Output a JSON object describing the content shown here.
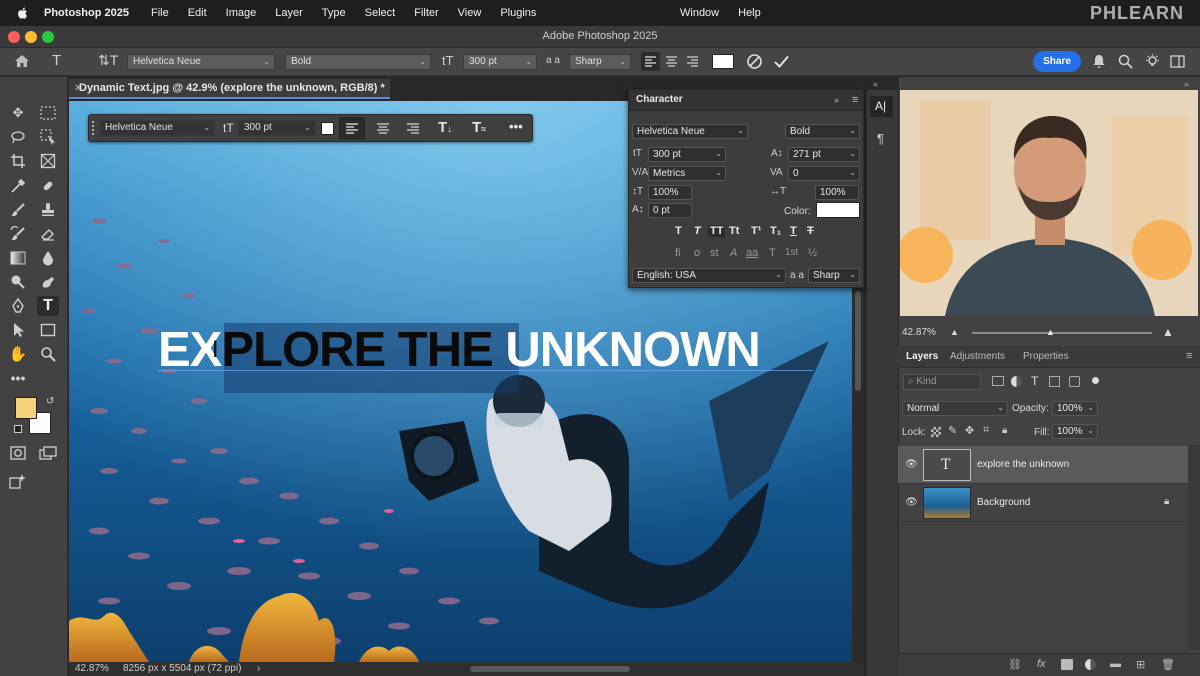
{
  "menubar": {
    "app_name": "Photoshop 2025",
    "items": [
      "File",
      "Edit",
      "Image",
      "Layer",
      "Type",
      "Select",
      "Filter",
      "View",
      "Plugins"
    ],
    "right_items": [
      "Window",
      "Help"
    ],
    "brand": "PHLEARN"
  },
  "window": {
    "title": "Adobe Photoshop 2025"
  },
  "options_bar": {
    "font_family": "Helvetica Neue",
    "font_style": "Bold",
    "font_size": "300 pt",
    "aa_label": "a a",
    "antialias": "Sharp",
    "share_label": "Share",
    "text_color": "#ffffff"
  },
  "document": {
    "tab_title": "Dynamic Text.jpg @ 42.9% (explore the unknown, RGB/8) *",
    "headline_white_1": "EX",
    "headline_black": "PLORE THE",
    "headline_white_2": " UNKNOWN",
    "zoom": "42.87%",
    "dimensions": "8256 px x 5504 px (72 ppi)"
  },
  "float_bar": {
    "font_family": "Helvetica Neue",
    "font_size": "300 pt"
  },
  "character_panel": {
    "title": "Character",
    "font_family": "Helvetica Neue",
    "font_style": "Bold",
    "font_size": "300 pt",
    "leading": "271 pt",
    "kerning": "Metrics",
    "tracking": "0",
    "vertical_scale": "100%",
    "horizontal_scale": "100%",
    "baseline_shift": "0 pt",
    "color_label": "Color:",
    "language": "English: USA",
    "aa_label": "a a",
    "antialias": "Sharp",
    "style_buttons": [
      "T",
      "T",
      "TT",
      "Tt",
      "T¹",
      "T₁",
      "T",
      "T"
    ],
    "opentype_buttons": [
      "fi",
      "o",
      "st",
      "A",
      "aa",
      "T",
      "1st",
      "½"
    ]
  },
  "navigator": {
    "zoom": "42.87%"
  },
  "layers_panel": {
    "tabs": [
      "Layers",
      "Adjustments",
      "Properties"
    ],
    "kind_placeholder": "Kind",
    "blend_mode": "Normal",
    "opacity_label": "Opacity:",
    "opacity": "100%",
    "lock_label": "Lock:",
    "fill_label": "Fill:",
    "fill": "100%",
    "layers": [
      {
        "name": "explore the unknown",
        "type": "text",
        "selected": true
      },
      {
        "name": "Background",
        "type": "image",
        "locked": true
      }
    ]
  },
  "colors": {
    "accent": "#2570e8",
    "foreground_swatch": "#f7d27a",
    "background_swatch": "#ffffff",
    "selection": "#5a8ad8"
  }
}
